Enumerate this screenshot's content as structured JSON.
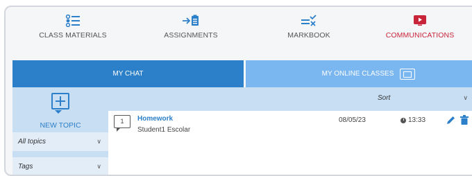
{
  "nav": {
    "items": [
      {
        "label": "CLASS MATERIALS",
        "icon": "list-icon"
      },
      {
        "label": "ASSIGNMENTS",
        "icon": "assignment-icon"
      },
      {
        "label": "MARKBOOK",
        "icon": "markbook-icon"
      },
      {
        "label": "COMMUNICATIONS",
        "icon": "play-icon",
        "active": true
      }
    ],
    "accent_color": "#2c7fc9",
    "active_color": "#c8243a"
  },
  "tabs": {
    "chat_label": "MY CHAT",
    "online_label": "MY ONLINE CLASSES",
    "online_icon": "screen-icon"
  },
  "sidebar": {
    "new_topic_label": "NEW TOPIC",
    "new_topic_icon": "add-chat-icon",
    "filters": [
      {
        "label": "All topics"
      },
      {
        "label": "Tags"
      }
    ]
  },
  "list": {
    "sort_label": "Sort",
    "topics": [
      {
        "count": "1",
        "title": "Homework",
        "author": "Student1 Escolar",
        "date": "08/05/23",
        "time": "13:33"
      }
    ]
  }
}
